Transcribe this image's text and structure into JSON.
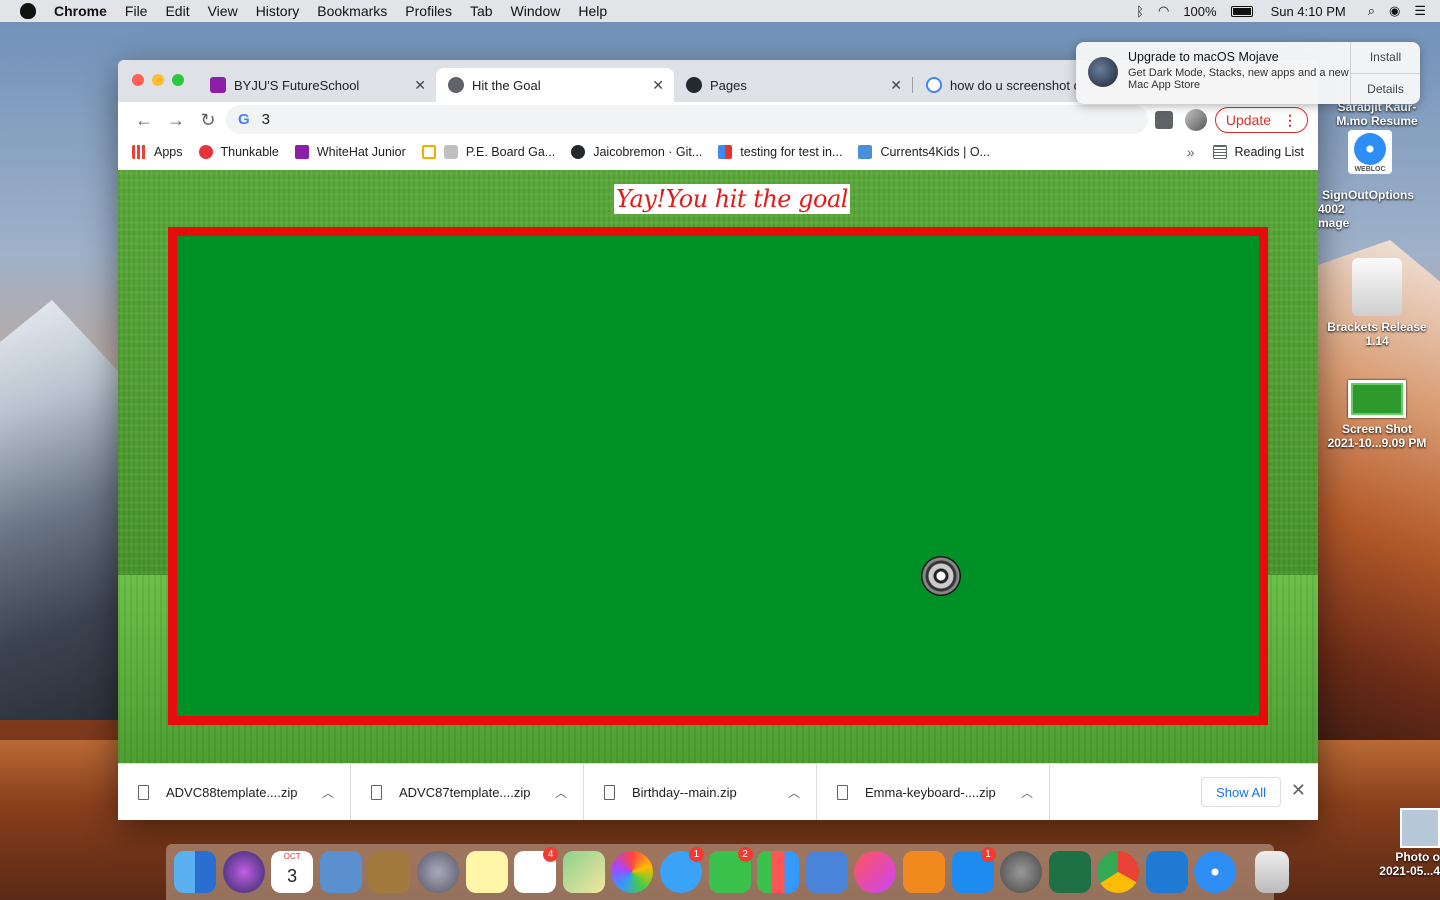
{
  "menubar": {
    "app_name": "Chrome",
    "items": [
      "File",
      "Edit",
      "View",
      "History",
      "Bookmarks",
      "Profiles",
      "Tab",
      "Window",
      "Help"
    ],
    "battery": "100%",
    "clock": "Sun 4:10 PM"
  },
  "tabs": [
    {
      "title": "BYJU'S FutureSchool",
      "favicon_color": "#8b1fa9"
    },
    {
      "title": "Hit the Goal",
      "favicon_color": "#5f6368"
    },
    {
      "title": "Pages",
      "favicon_color": "#24292e"
    },
    {
      "title": "how do u screenshot o",
      "favicon_color": "#4285f4"
    }
  ],
  "toolbar": {
    "address": "3",
    "update_label": "Update"
  },
  "bookmarks": {
    "items": [
      {
        "label": "Apps",
        "color": "#ea4335"
      },
      {
        "label": "Thunkable",
        "color": "#e8323c"
      },
      {
        "label": "WhiteHat Junior",
        "color": "#8b1fa9"
      },
      {
        "label": "",
        "color": "#f9ab00"
      },
      {
        "label": "P.E. Board Ga...",
        "color": "#c0c0c0"
      },
      {
        "label": "Jaicobremon · Git...",
        "color": "#24292e"
      },
      {
        "label": "testing for test in...",
        "color": "#e5322d"
      },
      {
        "label": "Currents4Kids | O...",
        "color": "#4a90d9"
      }
    ],
    "more": "»",
    "reading_list": "Reading List"
  },
  "game": {
    "message": "Yay!You hit the goal"
  },
  "downloads": {
    "files": [
      "ADVC88template....zip",
      "ADVC87template....zip",
      "Birthday--main.zip",
      "Emma-keyboard-....zip"
    ],
    "show_all": "Show All"
  },
  "notification": {
    "title": "Upgrade to macOS Mojave",
    "body": "Get Dark Mode, Stacks, new apps and a new Mac App Store",
    "install": "Install",
    "details": "Details"
  },
  "desktop_icons": [
    {
      "label1": "Sarabjit Kaur-",
      "label2": "M.mo Resume"
    },
    {
      "label1": "SignOutOptions",
      "label2": "4002",
      "label3": "mage"
    },
    {
      "label1": "Brackets Release",
      "label2": "1.14"
    },
    {
      "label1": "Screen Shot",
      "label2": "2021-10...9.09 PM"
    },
    {
      "label1": "Photo o",
      "label2": "2021-05...4"
    }
  ],
  "webloc_label": "WEBLOC",
  "dock": {
    "calendar_month": "OCT",
    "calendar_day": "3",
    "badges": {
      "reminders": "4",
      "messages": "1",
      "facetime": "2",
      "appstore": "1"
    }
  }
}
